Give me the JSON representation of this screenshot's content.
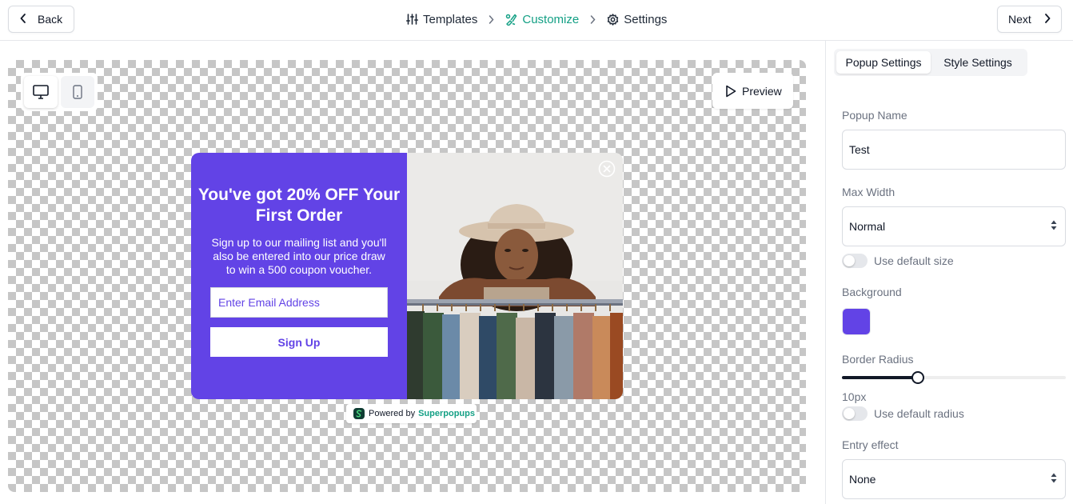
{
  "topbar": {
    "back_label": "Back",
    "next_label": "Next",
    "steps": [
      {
        "label": "Templates",
        "icon": "sliders-icon"
      },
      {
        "label": "Customize",
        "icon": "brush-icon",
        "active": true
      },
      {
        "label": "Settings",
        "icon": "gear-icon"
      }
    ]
  },
  "canvas": {
    "device_modes": [
      "desktop",
      "mobile"
    ],
    "active_device": "desktop",
    "preview_label": "Preview"
  },
  "popup": {
    "title": "You've got 20% OFF Your First Order",
    "body": "Sign up to our mailing list and you'll also be entered into our price draw to win a 500 coupon voucher.",
    "email_placeholder": "Enter Email Address",
    "signup_label": "Sign Up",
    "background_color": "#6243e6",
    "powered_prefix": "Powered by",
    "powered_brand": "Superpopups"
  },
  "panel": {
    "tabs": [
      "Popup Settings",
      "Style Settings"
    ],
    "active_tab": "Popup Settings",
    "popup_name_label": "Popup Name",
    "popup_name_value": "Test",
    "max_width_label": "Max Width",
    "max_width_value": "Normal",
    "use_default_size_label": "Use default size",
    "background_label": "Background",
    "background_color": "#6243e6",
    "border_radius_label": "Border Radius",
    "border_radius_value": "10px",
    "border_radius_fraction": 0.34,
    "use_default_radius_label": "Use default radius",
    "entry_effect_label": "Entry effect",
    "entry_effect_value": "None"
  }
}
